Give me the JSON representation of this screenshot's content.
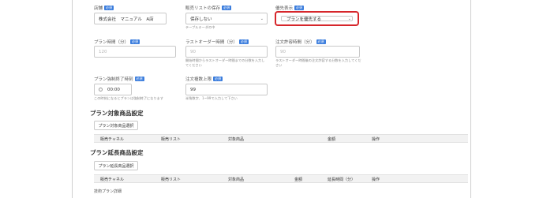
{
  "fields": {
    "store": {
      "label": "店舗",
      "req": "必須",
      "value": "株式会社　マニュアル　A店"
    },
    "sales_list_save": {
      "label": "販売リストの保存",
      "req": "必須",
      "value": "保存しない",
      "help": "テーブルキーダの中"
    },
    "priority": {
      "label": "優先表示",
      "req": "必須",
      "value": "プランを優先する"
    },
    "plan_time": {
      "label": "プラン時間（分）",
      "req": "必須",
      "placeholder": "120"
    },
    "last_order": {
      "label": "ラストオーダー時間（分）",
      "req": "必須",
      "placeholder": "90",
      "help": "開始時間からラストオーダー時間までの分数を入力してください"
    },
    "order_allow": {
      "label": "注文許容時間（分）",
      "req": "必須",
      "placeholder": "90",
      "help": "ラストオーダー時間後の注文許容する分数を入力してください"
    },
    "force_end": {
      "label": "プラン強制終了時刻",
      "req": "必須",
      "value": "00:00",
      "help": "この時刻になるとプランは強制終了になります"
    },
    "order_limit": {
      "label": "注文複数上限",
      "req": "必須",
      "value": "99",
      "help": "半角数字、1~99で入力して下さい"
    }
  },
  "plan_items": {
    "title": "プラン対象商品設定",
    "button": "プラン対象商品選択",
    "columns": [
      "販売チャネル",
      "販売リスト",
      "対象商品",
      "金額",
      "操作"
    ]
  },
  "plan_extension": {
    "title": "プラン延長商品設定",
    "button": "プラン延長商品選択",
    "columns": [
      "販売チャネル",
      "販売リスト",
      "対象商品",
      "金額",
      "延長時間（分）",
      "操作"
    ]
  },
  "footer_label": "技術プラン詳細",
  "colors": {
    "required_badge": "#3b7ddd",
    "highlight": "#d6262b",
    "header_bg": "#f2f2f2"
  }
}
